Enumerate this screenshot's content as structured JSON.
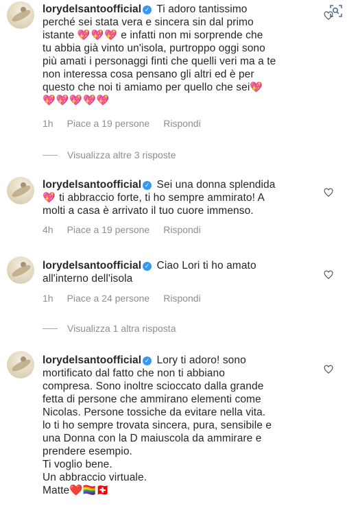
{
  "comments": [
    {
      "username": "lorydelsantoofficial",
      "lines": [
        "Ti adoro tantissimo",
        "perché sei stata vera e sincera sin dal primo",
        "istante",
        "e infatti non mi sorprende che",
        "tu abbia già vinto un'isola, purtroppo oggi sono",
        "più amati i personaggi finti che quelli veri ma a te",
        "non interessa cosa pensano gli altri ed è per",
        "questo che noi ti amiamo per quello che sei"
      ],
      "hearts_a": "💖💖💖",
      "hearts_b": "💖",
      "hearts_c": "💖💖💖💖💖",
      "time": "1h",
      "likes": "Piace a 19 persone",
      "reply": "Rispondi",
      "view_replies": "Visualizza altre 3 risposte"
    },
    {
      "username": "lorydelsantoofficial",
      "lines": [
        "Sei una donna splendida",
        "ti abbraccio forte, ti ho sempre ammirato! A",
        "molti a casa è arrivato il tuo cuore immenso."
      ],
      "heart": "💖",
      "time": "4h",
      "likes": "Piace a 19 persone",
      "reply": "Rispondi"
    },
    {
      "username": "lorydelsantoofficial",
      "lines": [
        "Ciao Lori ti ho amato",
        "all'interno dell'isola"
      ],
      "time": "1h",
      "likes": "Piace a 24 persone",
      "reply": "Rispondi",
      "view_replies": "Visualizza 1 altra risposta"
    },
    {
      "username": "lorydelsantoofficial",
      "lines": [
        "Lory ti adoro! sono",
        "mortificato dal fatto che non ti abbiano",
        "compresa. Sono inoltre scioccato dalla grande",
        "fetta di persone che ammirano elementi come",
        "Nicolas. Persone tossiche da evitare nella vita.",
        "lo ti ho sempre trovata sincera, pura, sensibile e",
        "una Donna con la D maiuscola da ammirare e",
        "prendere esempio.",
        "Ti voglio bene.",
        "Un abbraccio virtuale.",
        "Matte"
      ],
      "emoji_end": "❤️🏳️‍🌈🇨🇭"
    }
  ],
  "icons": {
    "like": "heart-outline-icon",
    "corner": "visual-search-icon",
    "verified": "verified-badge-icon"
  }
}
